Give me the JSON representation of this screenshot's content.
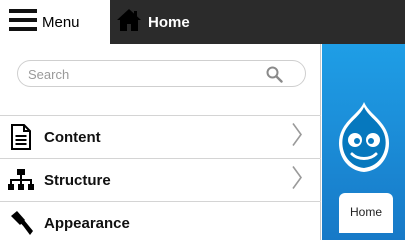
{
  "toolbar": {
    "menu_label": "Menu",
    "home_label": "Home"
  },
  "tray": {
    "search_placeholder": "Search",
    "items": [
      {
        "label": "Content",
        "icon": "document-icon",
        "has_children": true
      },
      {
        "label": "Structure",
        "icon": "sitemap-icon",
        "has_children": true
      },
      {
        "label": "Appearance",
        "icon": "paintbrush-icon",
        "has_children": false
      }
    ]
  },
  "page": {
    "tab_label": "Home"
  },
  "colors": {
    "toolbar_bg": "#2b2b2b",
    "content_blue": "#1f9ee6",
    "logo_blue": "#0678be"
  }
}
